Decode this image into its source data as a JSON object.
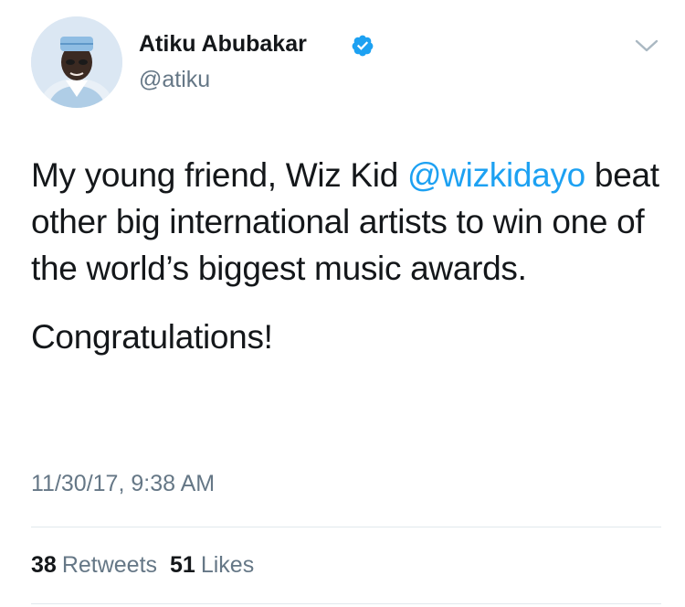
{
  "user": {
    "display_name": "Atiku Abubakar",
    "handle": "@atiku",
    "verified": true,
    "avatar_icon": "profile-photo",
    "verified_icon": "verified-badge-icon"
  },
  "menu": {
    "icon": "chevron-down-icon"
  },
  "tweet": {
    "line1_before": "My young friend, Wiz Kid ",
    "mention": "@wizkidayo",
    "line1_after": " beat other big international artists to win one of the world’s biggest music awards.",
    "paragraph2": "Congratulations!"
  },
  "timestamp": "11/30/17, 9:38 AM",
  "stats": {
    "retweets_count": "38",
    "retweets_label": "Retweets",
    "likes_count": "51",
    "likes_label": "Likes"
  },
  "colors": {
    "link": "#1da1f2",
    "secondary_text": "#657786",
    "primary_text": "#14171a",
    "divider": "#e1e8ed"
  }
}
